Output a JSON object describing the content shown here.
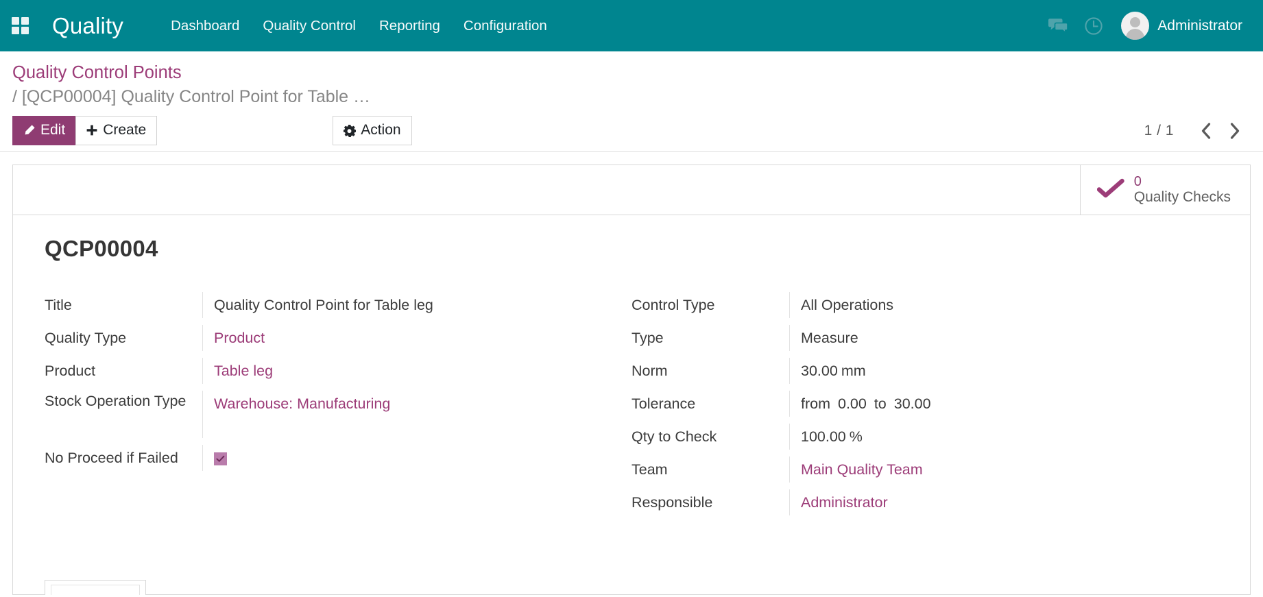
{
  "navbar": {
    "apps_icon": "apps-grid-icon",
    "brand": "Quality",
    "menu": [
      {
        "label": "Dashboard"
      },
      {
        "label": "Quality Control"
      },
      {
        "label": "Reporting"
      },
      {
        "label": "Configuration"
      }
    ],
    "messages_icon": "chat-bubble-icon",
    "activities_icon": "clock-icon",
    "avatar_icon": "user-avatar-icon",
    "user_name": "Administrator",
    "background_color": "#00858F"
  },
  "breadcrumb": {
    "root": "Quality Control Points",
    "separator": "/",
    "current": "[QCP00004] Quality Control Point for Table …"
  },
  "toolbar": {
    "edit_label": "Edit",
    "edit_icon": "pencil-icon",
    "create_label": "Create",
    "create_icon": "plus-icon",
    "action_label": "Action",
    "action_icon": "gear-icon",
    "pager_value": "1 / 1",
    "pager_previous_icon": "chevron-left-icon",
    "pager_next_icon": "chevron-right-icon"
  },
  "stat_buttons": [
    {
      "icon": "check-mark-icon",
      "value": "0",
      "label": "Quality Checks"
    }
  ],
  "record": {
    "title": "QCP00004",
    "left_fields": [
      {
        "label": "Title",
        "value": "Quality Control Point for Table leg",
        "link": false
      },
      {
        "label": "Quality Type",
        "value": "Product",
        "link": true
      },
      {
        "label": "Product",
        "value": "Table leg",
        "link": true
      },
      {
        "label": "Stock Operation Type",
        "value": "Warehouse: Manufacturing",
        "link": true
      },
      {
        "label": "No Proceed if Failed",
        "value": "checked",
        "link": false
      }
    ],
    "right_fields": [
      {
        "label": "Control Type",
        "value": "All Operations",
        "link": false
      },
      {
        "label": "Type",
        "value": "Measure",
        "link": false
      },
      {
        "label": "Norm",
        "value": "30.00 mm",
        "link": false
      },
      {
        "label": "Tolerance",
        "value": "from  0.00 to  30.00",
        "link": false
      },
      {
        "label": "Qty to Check",
        "value": "100.00 %",
        "link": false
      },
      {
        "label": "Team",
        "value": "Main Quality Team",
        "link": true
      },
      {
        "label": "Responsible",
        "value": "Administrator",
        "link": true
      }
    ],
    "tolerance": {
      "from_label": "from",
      "min": "0.00",
      "to_label": "to",
      "max": "30.00"
    },
    "norm": {
      "amount": "30.00",
      "uom": "mm"
    },
    "qty_to_check": {
      "amount": "100.00",
      "uom": "%"
    }
  },
  "colors": {
    "brand_teal": "#00858F",
    "accent_purple": "#8F3C72",
    "link_purple": "#9C3C78",
    "text_dark": "#3C3C3C"
  }
}
